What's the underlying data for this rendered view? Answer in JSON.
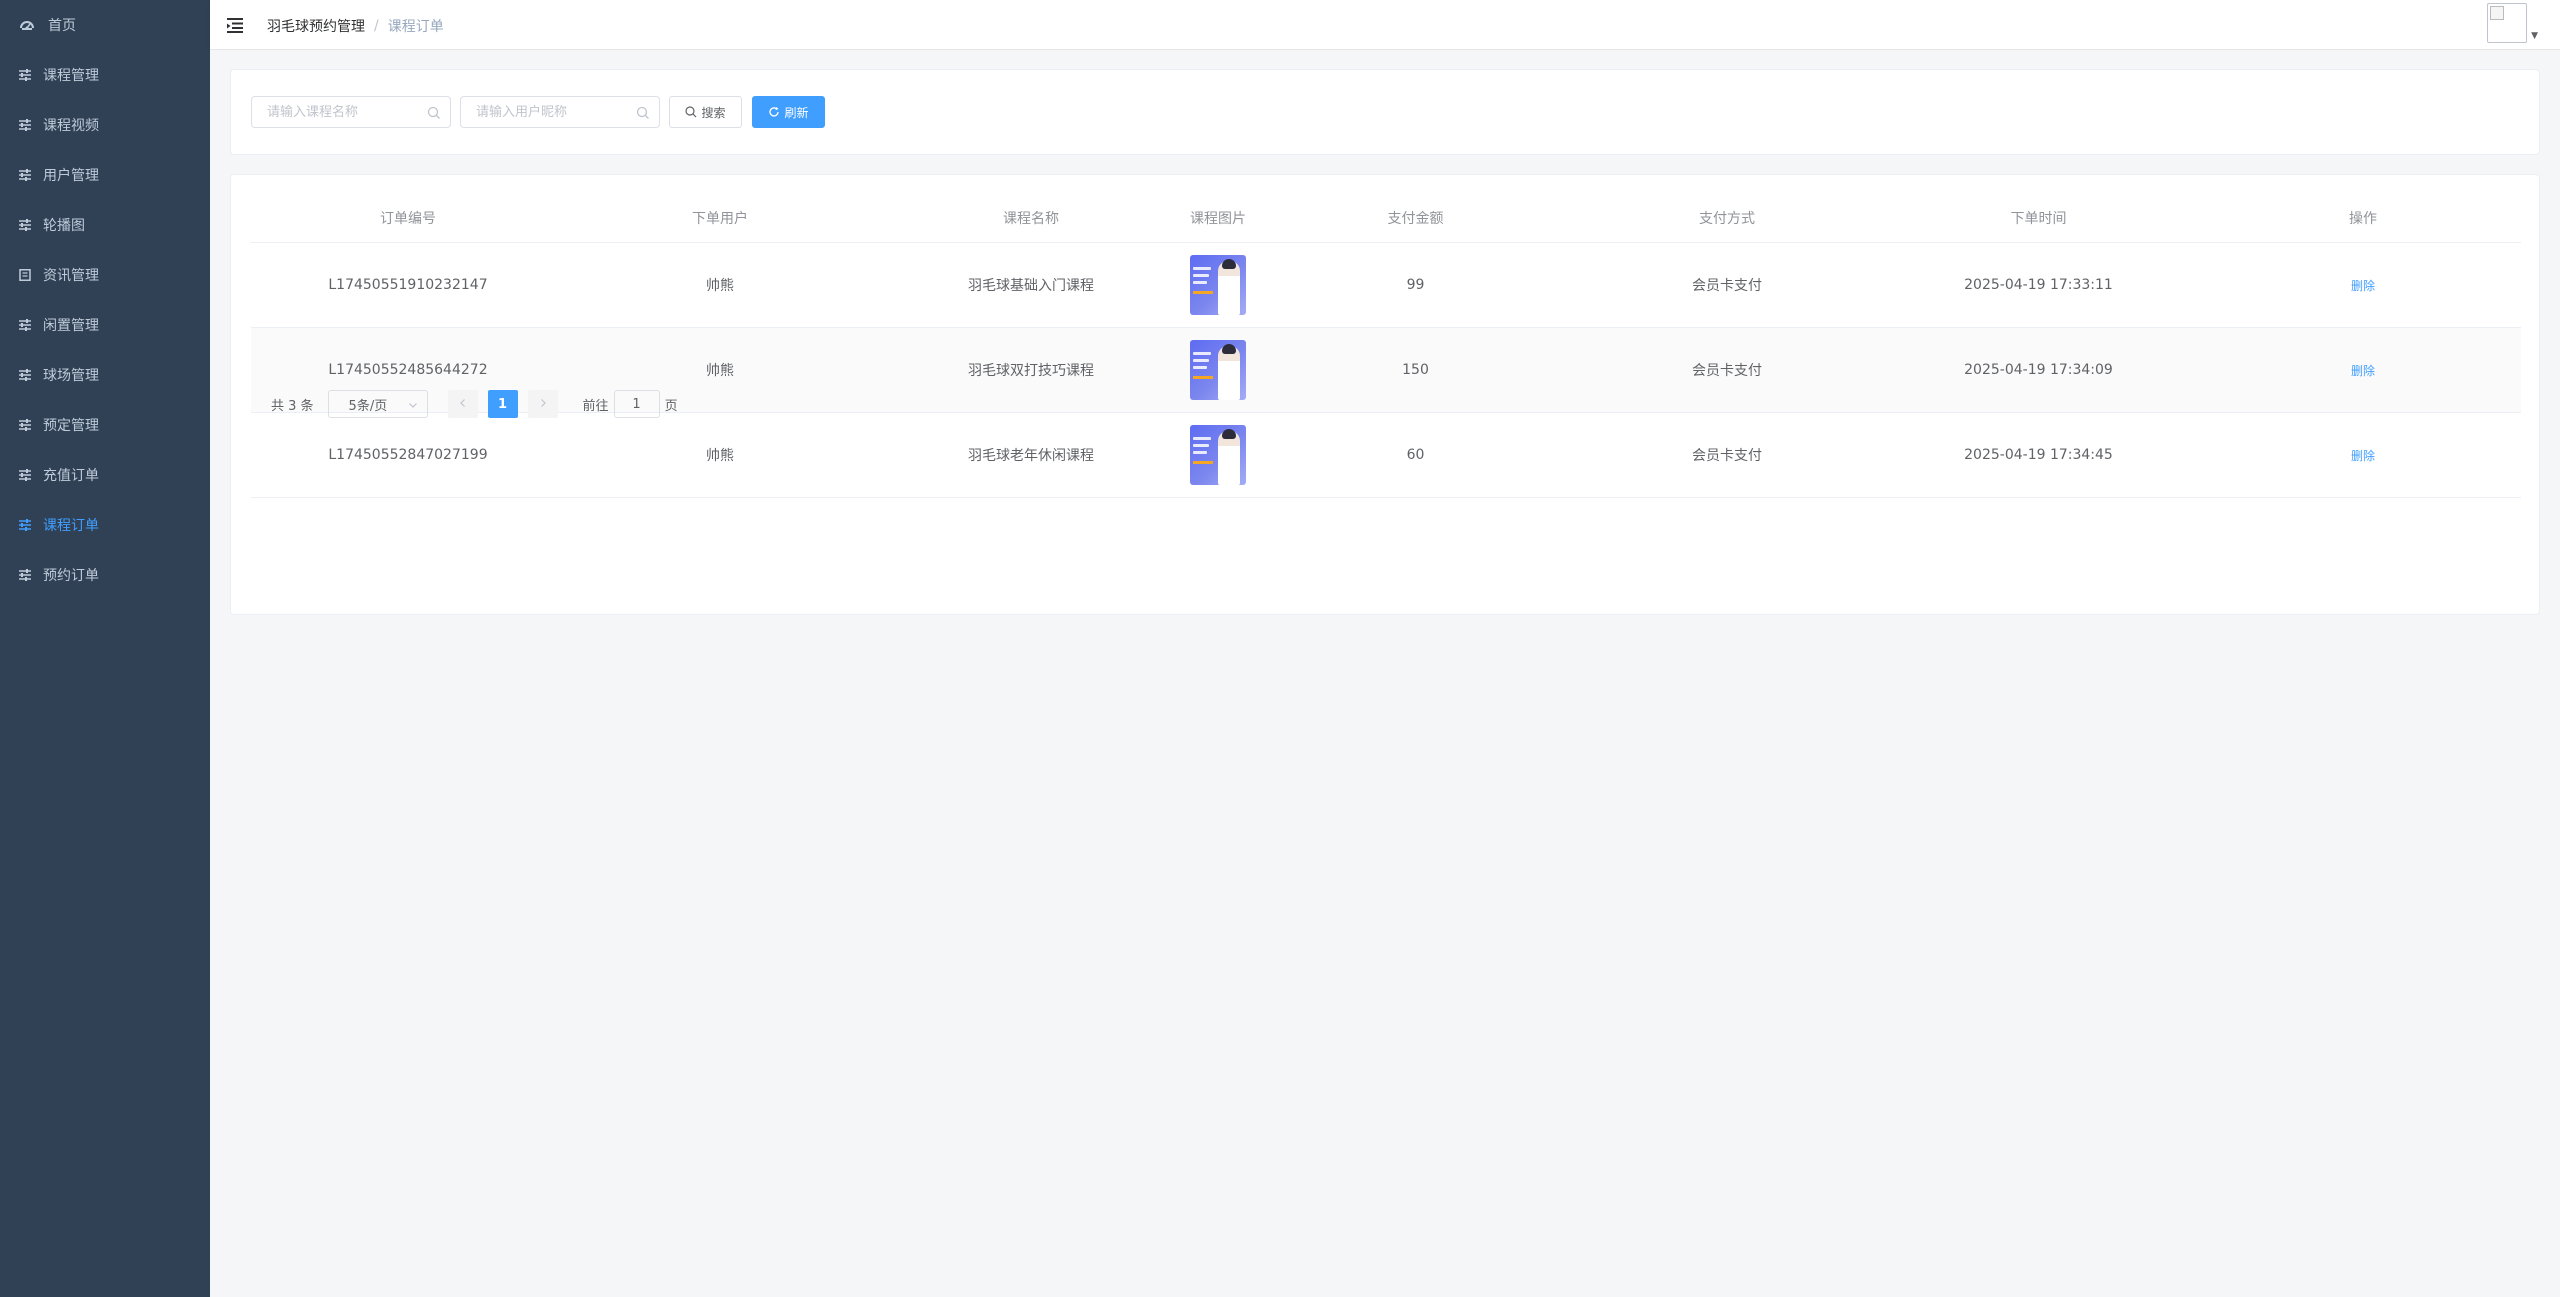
{
  "sidebar": {
    "items": [
      {
        "label": "首页",
        "icon": "dashboard-icon"
      },
      {
        "label": "课程管理",
        "icon": "sliders-icon"
      },
      {
        "label": "课程视频",
        "icon": "sliders-icon"
      },
      {
        "label": "用户管理",
        "icon": "sliders-icon"
      },
      {
        "label": "轮播图",
        "icon": "sliders-icon"
      },
      {
        "label": "资讯管理",
        "icon": "document-icon"
      },
      {
        "label": "闲置管理",
        "icon": "sliders-icon"
      },
      {
        "label": "球场管理",
        "icon": "sliders-icon"
      },
      {
        "label": "预定管理",
        "icon": "sliders-icon"
      },
      {
        "label": "充值订单",
        "icon": "sliders-icon"
      },
      {
        "label": "课程订单",
        "icon": "sliders-icon",
        "active": true
      },
      {
        "label": "预约订单",
        "icon": "sliders-icon"
      }
    ],
    "colors": {
      "background": "#304156",
      "text": "#bfcbd9",
      "active": "#409eff"
    }
  },
  "header": {
    "breadcrumb": {
      "home": "羽毛球预约管理",
      "separator": "/",
      "current": "课程订单"
    }
  },
  "search": {
    "course_placeholder": "请输入课程名称",
    "user_placeholder": "请输入用户昵称",
    "search_label": "搜索",
    "refresh_label": "刷新"
  },
  "table": {
    "columns": [
      "订单编号",
      "下单用户",
      "课程名称",
      "课程图片",
      "支付金额",
      "支付方式",
      "下单时间",
      "操作"
    ],
    "rows": [
      {
        "order_no": "L17450551910232147",
        "user": "帅熊",
        "course": "羽毛球基础入门课程",
        "amount": "99",
        "pay_method": "会员卡支付",
        "time": "2025-04-19 17:33:11",
        "action": "删除"
      },
      {
        "order_no": "L17450552485644272",
        "user": "帅熊",
        "course": "羽毛球双打技巧课程",
        "amount": "150",
        "pay_method": "会员卡支付",
        "time": "2025-04-19 17:34:09",
        "action": "删除"
      },
      {
        "order_no": "L17450552847027199",
        "user": "帅熊",
        "course": "羽毛球老年休闲课程",
        "amount": "60",
        "pay_method": "会员卡支付",
        "time": "2025-04-19 17:34:45",
        "action": "删除"
      }
    ]
  },
  "pagination": {
    "total": "共 3 条",
    "page_size": "5条/页",
    "current_page": "1",
    "goto_label": "前往",
    "goto_value": "1",
    "page_suffix": "页"
  },
  "theme": {
    "primary": "#409eff"
  }
}
